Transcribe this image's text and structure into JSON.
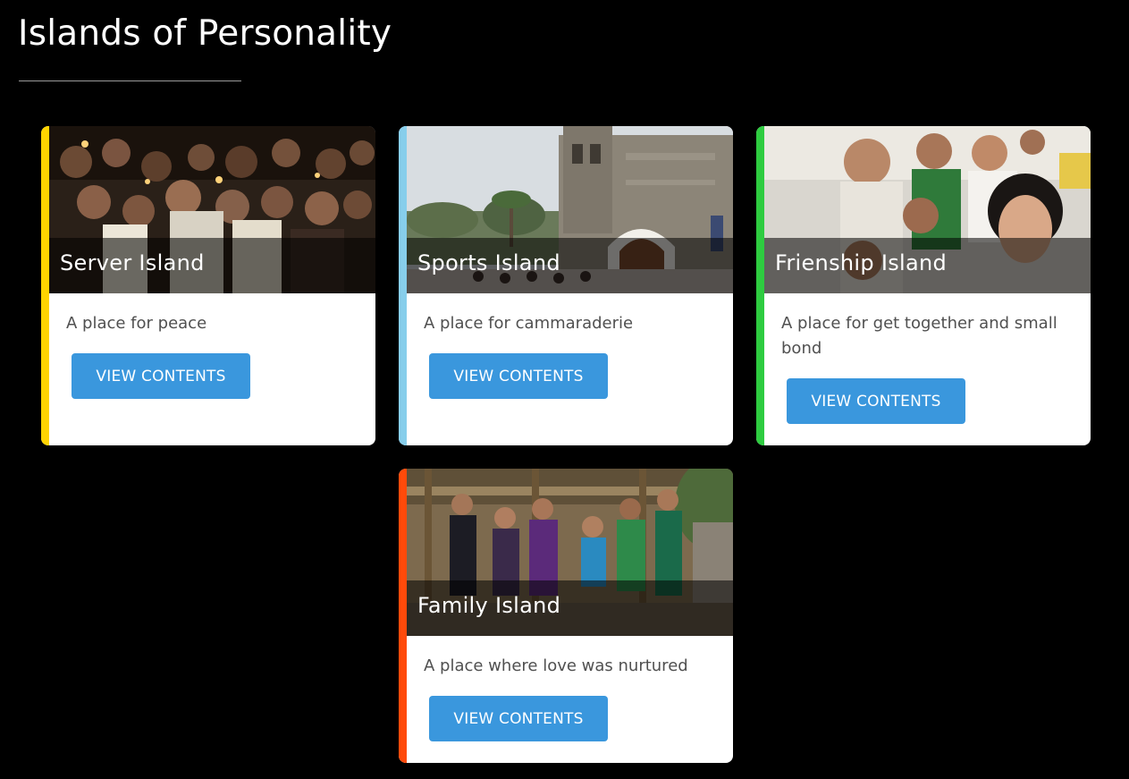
{
  "page": {
    "title": "Islands of Personality"
  },
  "colors": {
    "background": "#000000",
    "button": "#3a97dd",
    "description_text": "#505050"
  },
  "cards": [
    {
      "title": "Server Island",
      "description": "A place for peace",
      "button_label": "VIEW CONTENTS",
      "accent_color": "#ffd400",
      "image": "candlelight-mass-photo"
    },
    {
      "title": "Sports Island",
      "description": "A place for cammaraderie",
      "button_label": "VIEW CONTENTS",
      "accent_color": "#87ceeb",
      "image": "stone-church-photo"
    },
    {
      "title": "Frienship Island",
      "description": "A place for get together and small bond",
      "button_label": "VIEW CONTENTS",
      "accent_color": "#2ecc40",
      "image": "friends-group-selfie-photo"
    },
    {
      "title": "Family Island",
      "description": "A place where love was nurtured",
      "button_label": "VIEW CONTENTS",
      "accent_color": "#ff4a0a",
      "image": "family-group-photo"
    }
  ]
}
